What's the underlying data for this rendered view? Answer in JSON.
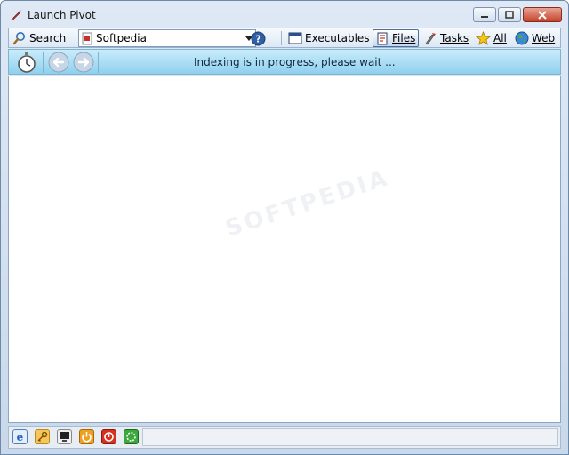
{
  "window": {
    "title": "Launch Pivot",
    "icon": "rocket-icon"
  },
  "toolbar": {
    "search_label": "Search",
    "search_icon": "magnifier-icon",
    "combo_value": "Softpedia",
    "combo_icon": "document-icon",
    "help_icon": "help-icon",
    "tabs": [
      {
        "label": "Executables",
        "icon": "window-icon",
        "active": false
      },
      {
        "label": "Files",
        "icon": "files-icon",
        "active": true
      },
      {
        "label": "Tasks",
        "icon": "tasks-icon",
        "active": false
      },
      {
        "label": "All",
        "icon": "star-icon",
        "active": false
      },
      {
        "label": "Web",
        "icon": "globe-icon",
        "active": false
      }
    ]
  },
  "navbar": {
    "status": "Indexing is in progress, please wait ...",
    "icons": [
      "stopwatch-icon",
      "back-arrow-icon",
      "forward-arrow-icon"
    ]
  },
  "content": {
    "watermark": "SOFTPEDIA"
  },
  "bottombar": {
    "icons": [
      "ie-icon",
      "key-icon",
      "computer-icon",
      "power-icon",
      "shutdown-icon",
      "restart-icon"
    ]
  },
  "colors": {
    "navbar_top": "#c9ecfb",
    "navbar_bottom": "#8fd0ee",
    "close_button": "#c4422b",
    "accent": "#2a5f9e"
  }
}
